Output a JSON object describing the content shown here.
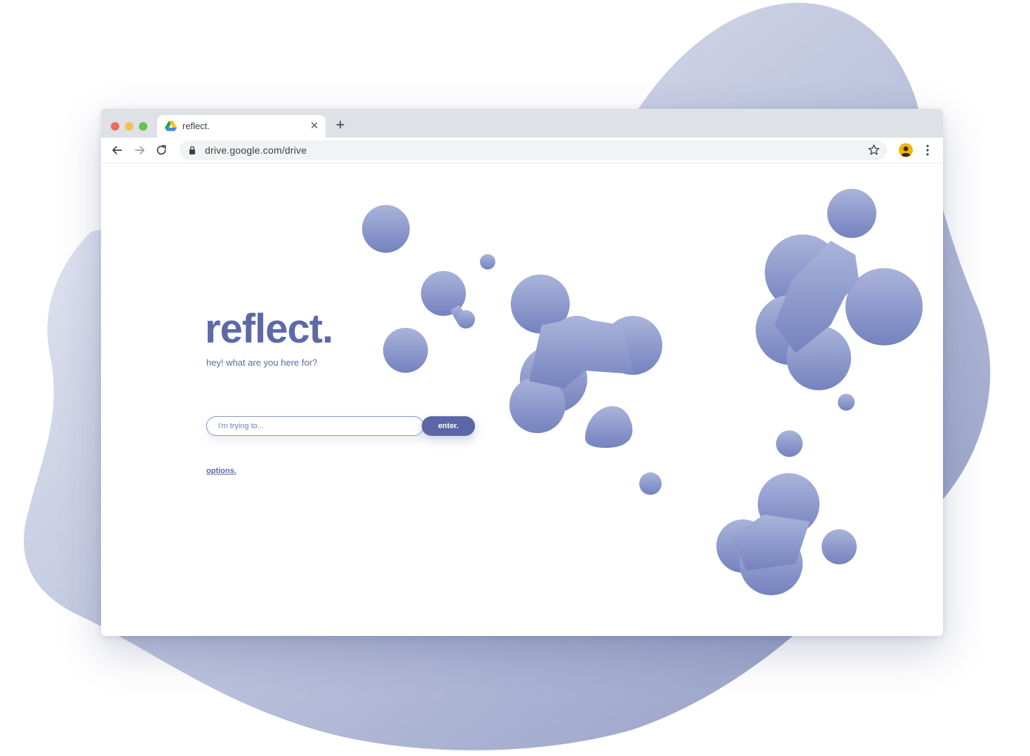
{
  "browser": {
    "tab": {
      "title": "reflect.",
      "favicon": "google-drive-icon",
      "close_icon": "close-icon"
    },
    "new_tab_icon": "plus-icon",
    "toolbar": {
      "back_icon": "arrow-left-icon",
      "forward_icon": "arrow-right-icon",
      "reload_icon": "reload-icon",
      "lock_icon": "lock-icon",
      "url": "drive.google.com/drive",
      "bookmark_icon": "star-icon",
      "profile_icon": "avatar",
      "menu_icon": "more-vert-icon"
    },
    "colors": {
      "traffic_red": "#ee6a5e",
      "traffic_yellow": "#f5be4f",
      "traffic_green": "#61c454"
    }
  },
  "page": {
    "logo": "reflect.",
    "subtitle": "hey! what are you here for?",
    "search": {
      "placeholder": "i'm trying to...",
      "value": ""
    },
    "enter_label": "enter.",
    "options_label": "options."
  },
  "theme": {
    "accent": "#5c6aa8",
    "blob_light": "#a5b0d7",
    "blob_dark": "#7784c1",
    "background_blob": "#a9b2d1"
  }
}
